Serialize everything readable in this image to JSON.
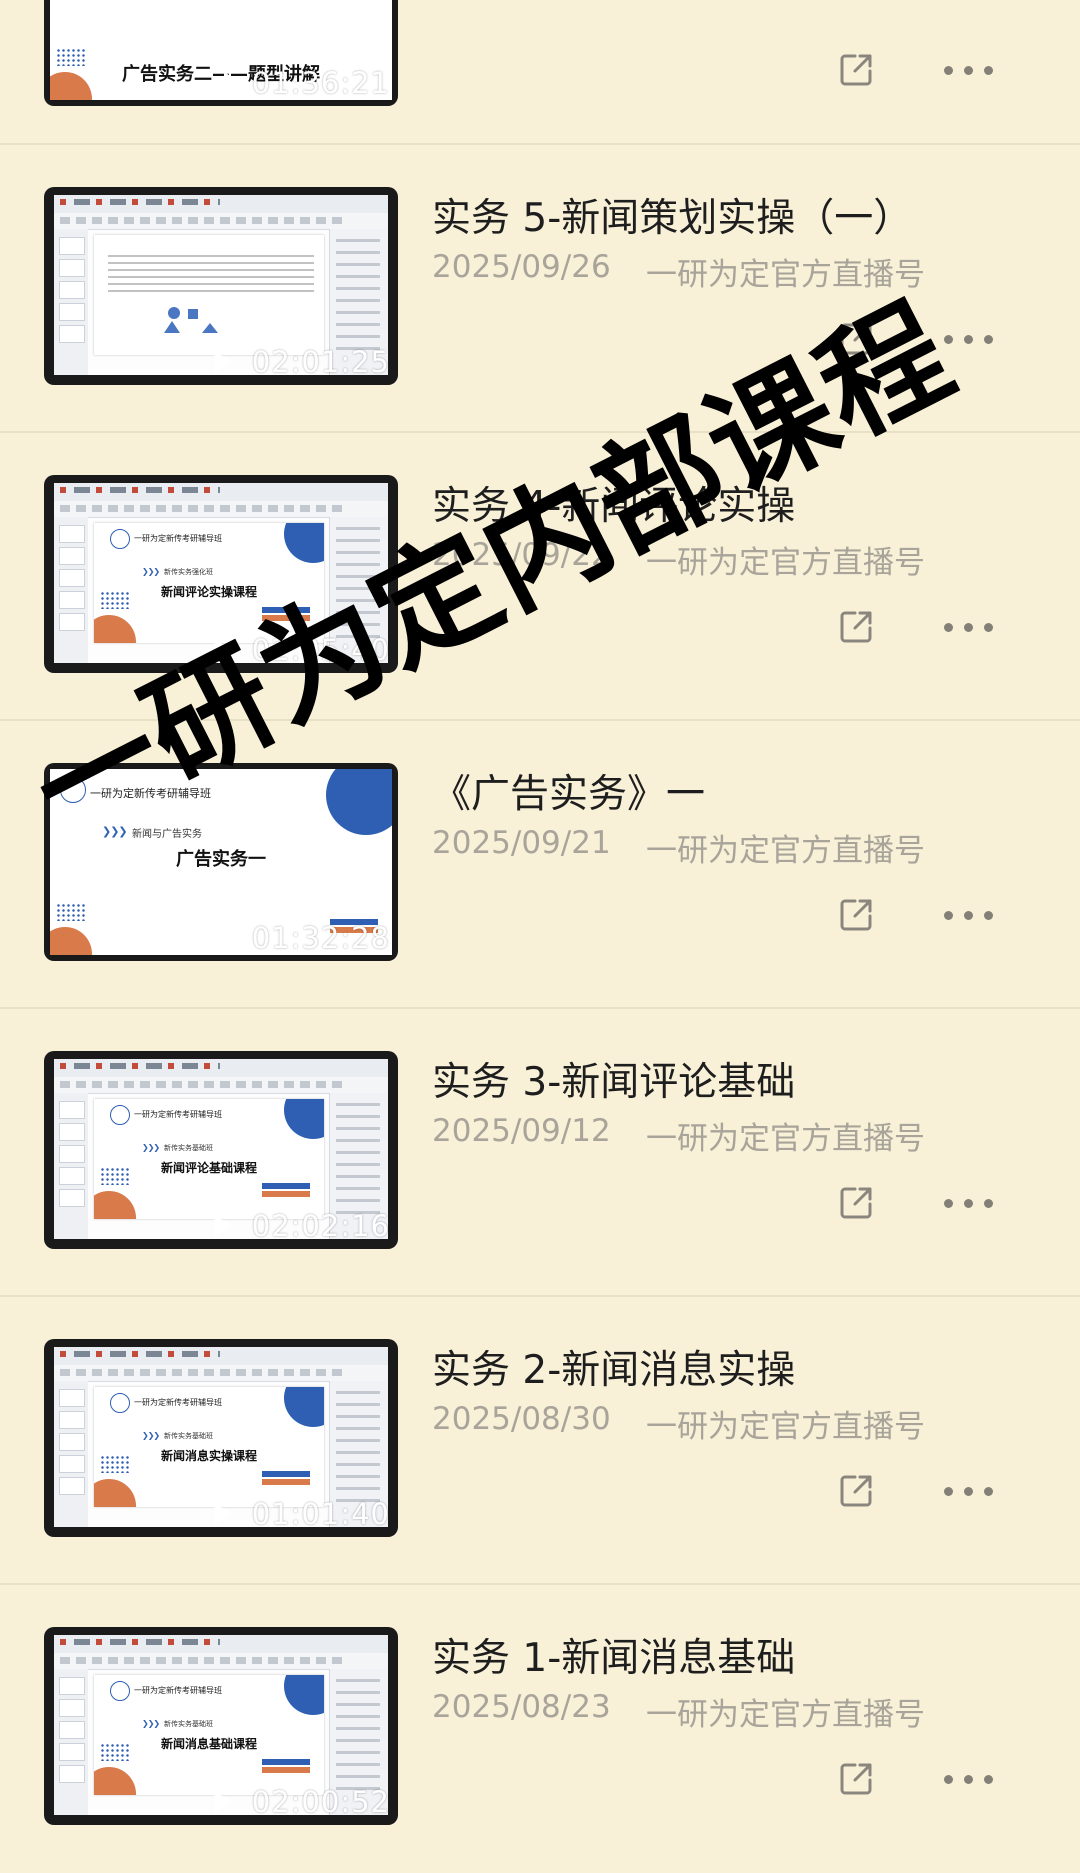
{
  "watermark": "一研为定内部课程",
  "partial_top": {
    "slide_title": "广告实务二——题型讲解",
    "duration": "01:36:21"
  },
  "videos": [
    {
      "title": "实务 5-新闻策划实操（一）",
      "date": "2025/09/26",
      "author": "一研为定官方直播号",
      "duration": "02:01:25",
      "slide_variant": "text"
    },
    {
      "title": "实务 4-新闻评论实操",
      "date": "2025/09/22",
      "author": "一研为定官方直播号",
      "duration": "02:05:40",
      "slide_variant": "cover",
      "slide_brand": "一研为定新传考研辅导班",
      "slide_sub": "新传实务强化班",
      "slide_big": "新闻评论实操课程"
    },
    {
      "title": "《广告实务》一",
      "date": "2025/09/21",
      "author": "一研为定官方直播号",
      "duration": "01:32:28",
      "slide_variant": "full",
      "slide_brand": "一研为定新传考研辅导班",
      "slide_sub": "新闻与广告实务",
      "slide_big": "广告实务一"
    },
    {
      "title": "实务 3-新闻评论基础",
      "date": "2025/09/12",
      "author": "一研为定官方直播号",
      "duration": "02:02:16",
      "slide_variant": "cover",
      "slide_brand": "一研为定新传考研辅导班",
      "slide_sub": "新传实务基础班",
      "slide_big": "新闻评论基础课程"
    },
    {
      "title": "实务 2-新闻消息实操",
      "date": "2025/08/30",
      "author": "一研为定官方直播号",
      "duration": "01:01:40",
      "slide_variant": "cover",
      "slide_brand": "一研为定新传考研辅导班",
      "slide_sub": "新传实务基础班",
      "slide_big": "新闻消息实操课程"
    },
    {
      "title": "实务 1-新闻消息基础",
      "date": "2025/08/23",
      "author": "一研为定官方直播号",
      "duration": "02:00:52",
      "slide_variant": "cover",
      "slide_brand": "一研为定新传考研辅导班",
      "slide_sub": "新传实务基础班",
      "slide_big": "新闻消息基础课程"
    }
  ]
}
